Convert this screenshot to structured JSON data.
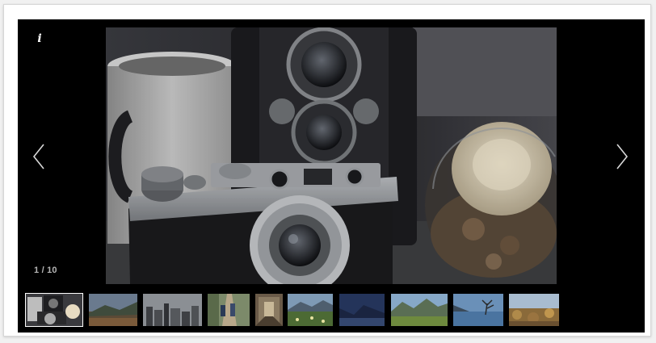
{
  "gallery": {
    "info_label": "i",
    "counter": "1 / 10",
    "colors": {
      "background": "#000000",
      "frame": "#ffffff",
      "nav_arrow": "#d8d8d8",
      "counter_text": "#b5b5b5"
    },
    "icons": {
      "info": "info-icon",
      "prev": "chevron-left-icon",
      "next": "chevron-right-icon"
    },
    "current_index": 1,
    "total": 10
  }
}
